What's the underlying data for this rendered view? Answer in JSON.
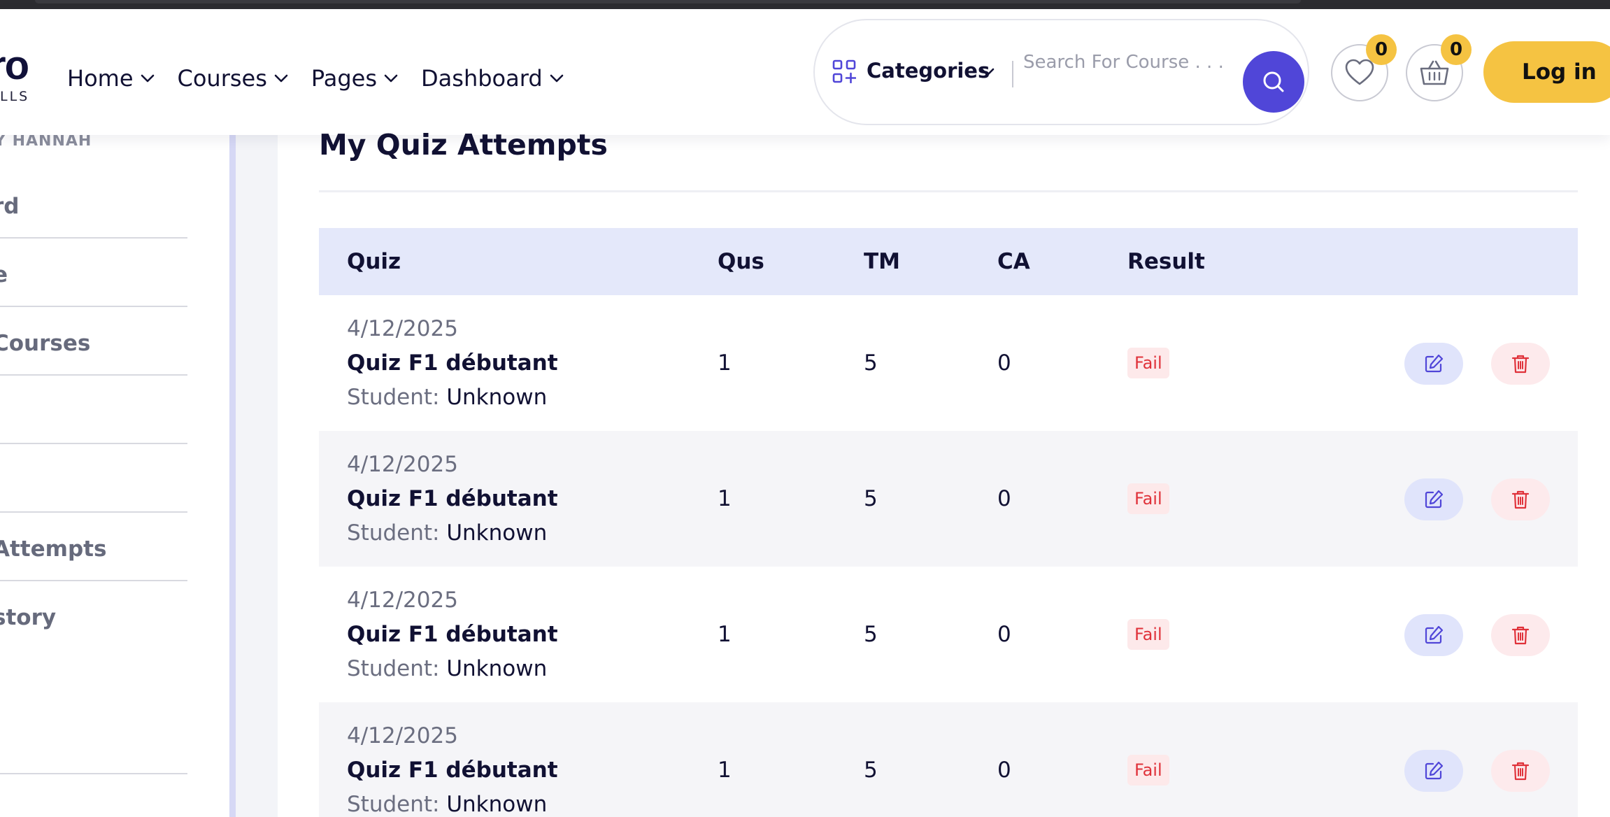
{
  "header": {
    "logo_text": "ro",
    "logo_sub": "LLS",
    "nav": [
      {
        "label": "Home"
      },
      {
        "label": "Courses"
      },
      {
        "label": "Pages"
      },
      {
        "label": "Dashboard"
      }
    ],
    "categories_label": "Categories",
    "search_placeholder": "Search For Course . . .",
    "wishlist_count": "0",
    "cart_count": "0",
    "login_label": "Log in",
    "colors": {
      "search_button": "#5046d8",
      "login_button": "#f5c342",
      "badge": "#f5c342"
    }
  },
  "sidebar": {
    "user_label": "Y HANNAH",
    "items": [
      {
        "label": "rd"
      },
      {
        "label": "e"
      },
      {
        "label": "Courses"
      },
      {
        "label": ""
      },
      {
        "label": ""
      },
      {
        "label": "Attempts"
      },
      {
        "label": "story"
      },
      {
        "label": ""
      }
    ]
  },
  "main": {
    "title": "My Quiz Attempts",
    "columns": [
      "Quiz",
      "Qus",
      "TM",
      "CA",
      "Result"
    ],
    "student_label": "Student:",
    "rows": [
      {
        "date": "4/12/2025",
        "quiz": "Quiz F1 débutant",
        "student": "Unknown",
        "qus": "1",
        "tm": "5",
        "ca": "0",
        "result": "Fail"
      },
      {
        "date": "4/12/2025",
        "quiz": "Quiz F1 débutant",
        "student": "Unknown",
        "qus": "1",
        "tm": "5",
        "ca": "0",
        "result": "Fail"
      },
      {
        "date": "4/12/2025",
        "quiz": "Quiz F1 débutant",
        "student": "Unknown",
        "qus": "1",
        "tm": "5",
        "ca": "0",
        "result": "Fail"
      },
      {
        "date": "4/12/2025",
        "quiz": "Quiz F1 débutant",
        "student": "Unknown",
        "qus": "1",
        "tm": "5",
        "ca": "0",
        "result": "Fail"
      }
    ],
    "icons": {
      "edit": "edit-icon",
      "delete": "trash-icon"
    },
    "colors": {
      "fail_text": "#e0323a",
      "fail_bg": "#fde9ea",
      "header_bg": "#e4e8fa"
    }
  }
}
